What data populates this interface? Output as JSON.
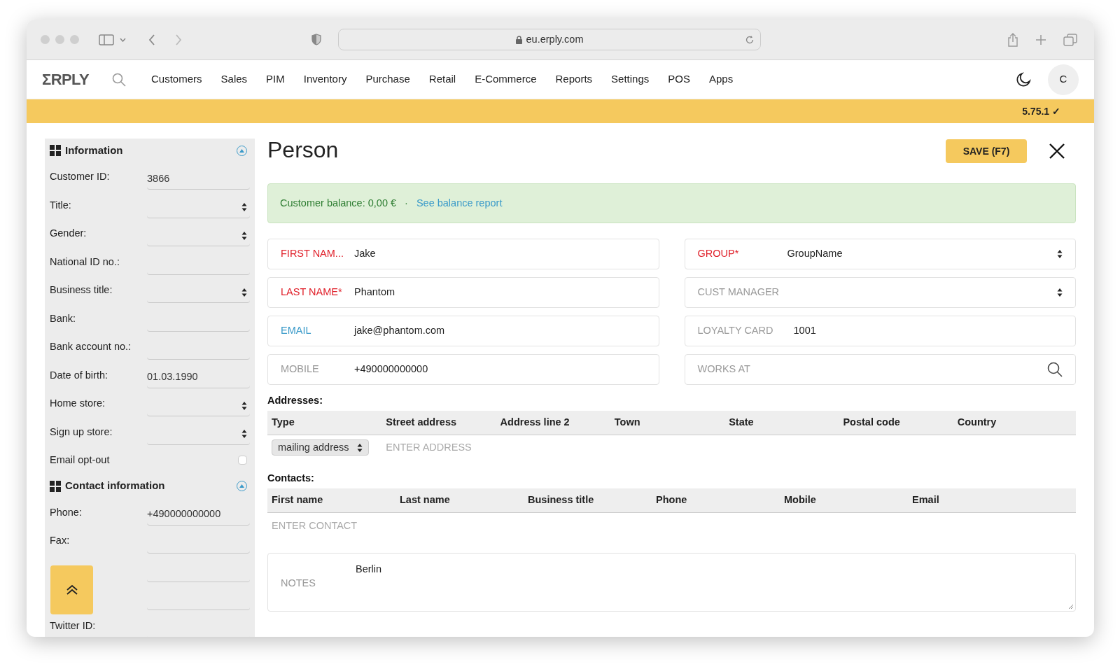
{
  "browser": {
    "url": "eu.erply.com"
  },
  "nav": {
    "logo": "ΣRPLY",
    "items": [
      "Customers",
      "Sales",
      "PIM",
      "Inventory",
      "Purchase",
      "Retail",
      "E-Commerce",
      "Reports",
      "Settings",
      "POS",
      "Apps"
    ],
    "avatar": "C"
  },
  "version": "5.75.1 ✓",
  "sidebar": {
    "sections": [
      {
        "title": "Information",
        "expanded": true,
        "rows": [
          {
            "kind": "text",
            "label": "Customer ID:",
            "value": "3866"
          },
          {
            "kind": "select",
            "label": "Title:"
          },
          {
            "kind": "select",
            "label": "Gender:"
          },
          {
            "kind": "text",
            "label": "National ID no.:"
          },
          {
            "kind": "select",
            "label": "Business title:"
          },
          {
            "kind": "text",
            "label": "Bank:"
          },
          {
            "kind": "text",
            "label": "Bank account no.:"
          },
          {
            "kind": "text",
            "label": "Date of birth:",
            "value": "01.03.1990"
          },
          {
            "kind": "select",
            "label": "Home store:"
          },
          {
            "kind": "select",
            "label": "Sign up store:"
          },
          {
            "kind": "checkbox",
            "label": "Email opt-out",
            "checked": false
          }
        ]
      },
      {
        "title": "Contact information",
        "expanded": true,
        "rows": [
          {
            "kind": "text",
            "label": "Phone:",
            "value": "+490000000000"
          },
          {
            "kind": "text",
            "label": "Fax:"
          },
          {
            "kind": "text"
          },
          {
            "kind": "text"
          },
          {
            "kind": "text",
            "label": "Twitter ID:"
          }
        ]
      }
    ]
  },
  "page": {
    "title": "Person",
    "save_button": "SAVE (F7)",
    "balance": {
      "text": "Customer balance: 0,00 €",
      "separator": "·",
      "link": "See balance report"
    },
    "left_fields": [
      {
        "label": "FIRST NAM...",
        "value": "Jake",
        "required": true,
        "focused": false
      },
      {
        "label": "LAST NAME*",
        "value": "Phantom",
        "required": true,
        "focused": false
      },
      {
        "label": "EMAIL",
        "value": "jake@phantom.com",
        "required": false,
        "focused": true
      },
      {
        "label": "MOBILE",
        "value": "+490000000000",
        "required": false,
        "focused": false
      }
    ],
    "right_fields": [
      {
        "kind": "select",
        "label": "GROUP*",
        "value": "GroupName",
        "required": true
      },
      {
        "kind": "select",
        "label": "CUST MANAGER",
        "required": false
      },
      {
        "kind": "text",
        "label": "LOYALTY CARD",
        "value": "1001",
        "required": false
      },
      {
        "kind": "search",
        "label": "WORKS AT",
        "required": false
      }
    ],
    "addresses": {
      "title": "Addresses:",
      "columns": [
        "Type",
        "Street address",
        "Address line 2",
        "Town",
        "State",
        "Postal code",
        "Country"
      ],
      "type_select": "mailing address",
      "placeholder": "ENTER ADDRESS"
    },
    "contacts": {
      "title": "Contacts:",
      "columns": [
        "First name",
        "Last name",
        "Business title",
        "Phone",
        "Mobile",
        "Email"
      ],
      "placeholder": "ENTER CONTACT"
    },
    "notes": {
      "label": "NOTES",
      "value": "Berlin"
    }
  }
}
